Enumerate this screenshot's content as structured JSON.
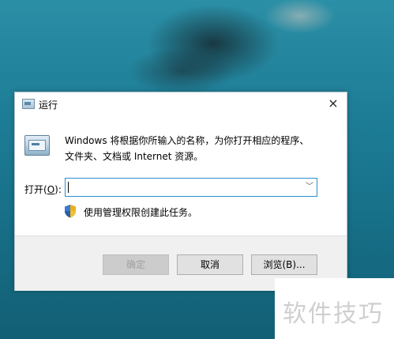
{
  "dialog": {
    "title": "运行",
    "description_line1": "Windows 将根据你所输入的名称，为你打开相应的程序、",
    "description_line2": "文件夹、文档或 Internet 资源。",
    "open_label_prefix": "打开(",
    "open_label_key": "O",
    "open_label_suffix": "):",
    "open_value": "",
    "admin_text": "使用管理权限创建此任务。",
    "buttons": {
      "ok": "确定",
      "cancel": "取消",
      "browse": "浏览(B)..."
    }
  },
  "icons": {
    "close": "×",
    "dropdown": "﹀"
  },
  "watermark": "软件技巧",
  "colors": {
    "focus_border": "#2a8fd0",
    "footer_bg": "#f0f0f0"
  }
}
